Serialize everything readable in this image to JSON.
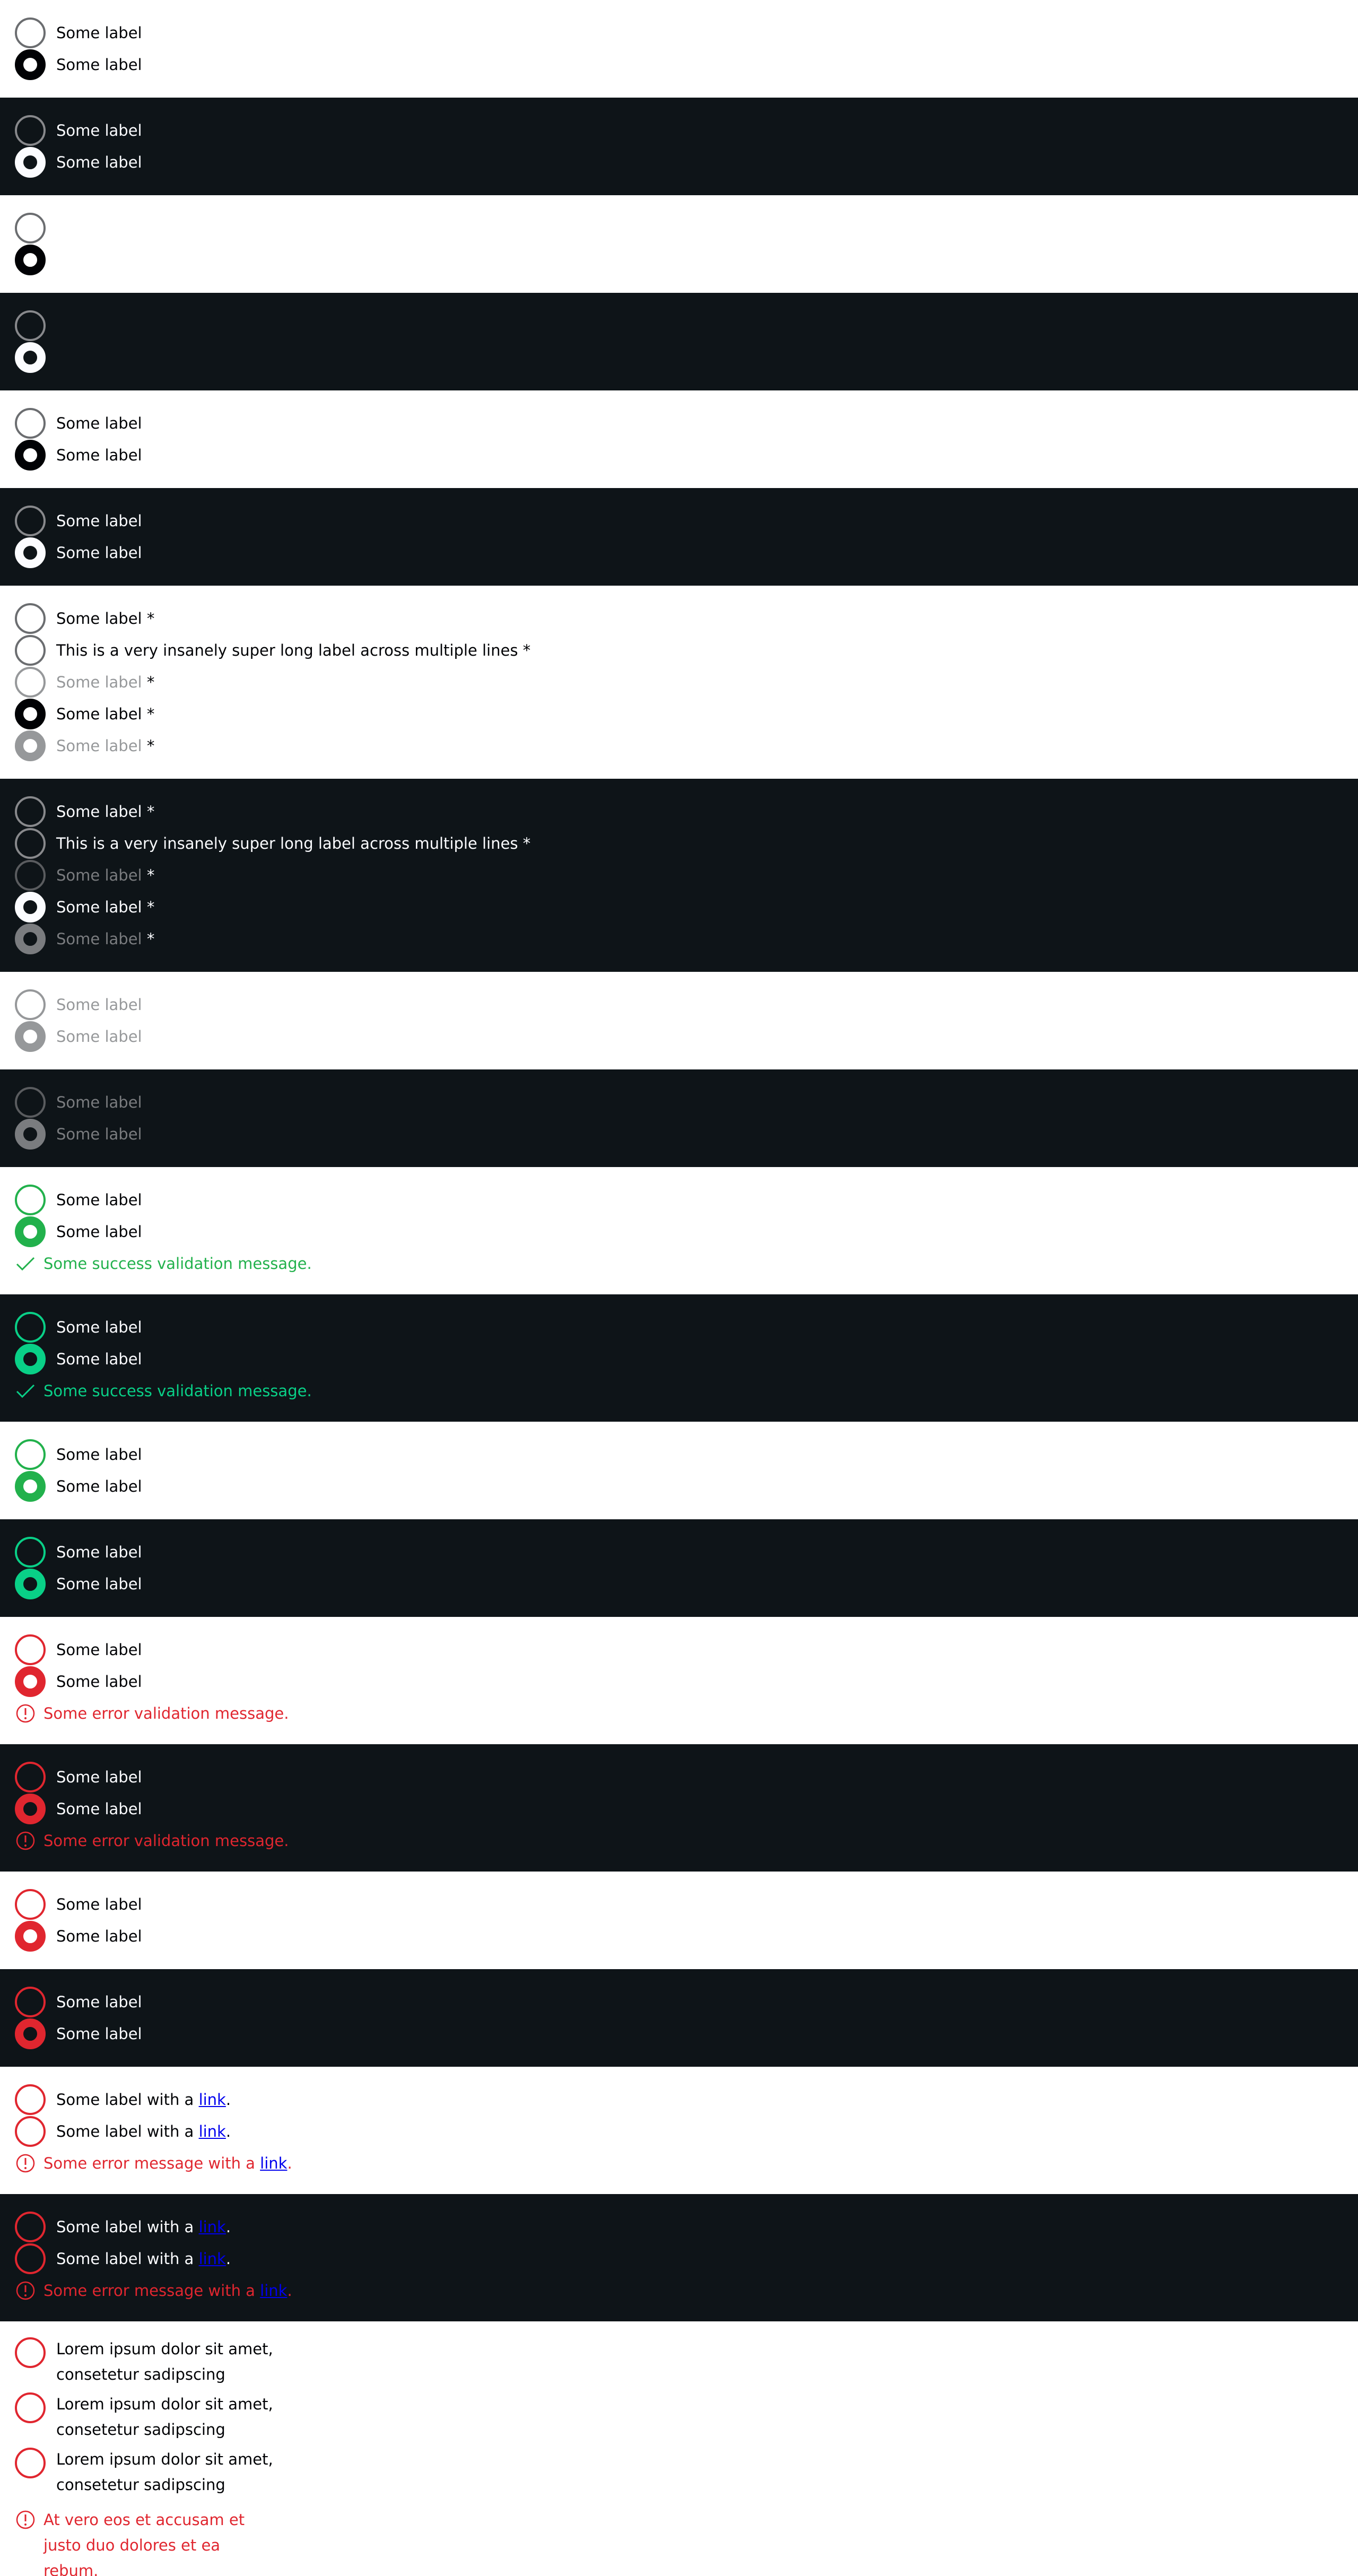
{
  "label": "Some label",
  "label_required": "Some label *",
  "label_long_required": "This is a very insanely super long label across multiple lines *",
  "asterisk": "*",
  "success_message": "Some success validation message.",
  "error_message": "Some error validation message.",
  "label_with_link_prefix": "Some label with a ",
  "link_text": "link",
  "period": ".",
  "error_link_prefix": "Some error message with a ",
  "lorem_label": "Lorem ipsum dolor sit amet, consetetur sadipscing",
  "lorem_error": "At vero eos et accusam et justo duo dolores et ea rebum.",
  "colors": {
    "light_bg": "#ffffff",
    "dark_bg": "#0e1418",
    "success": "#22b14c",
    "success_dark": "#09d087",
    "error": "#e0262f",
    "link": "#0000ee"
  },
  "icons": {
    "success": "checkmark-icon",
    "error": "exclamation-circle-icon"
  }
}
